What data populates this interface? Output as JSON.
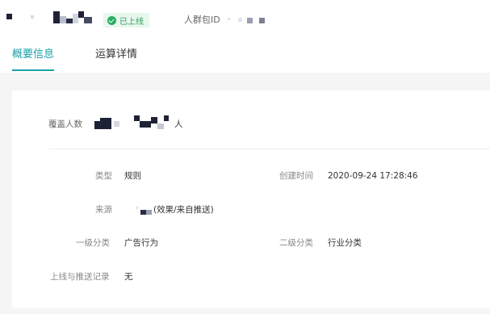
{
  "header": {
    "status": "已上线",
    "crowd_id_label": "人群包ID"
  },
  "tabs": [
    {
      "label": "概要信息",
      "active": true
    },
    {
      "label": "运算详情",
      "active": false
    }
  ],
  "coverage": {
    "label": "覆盖人数",
    "unit": "人"
  },
  "fields": {
    "type": {
      "label": "类型",
      "value": "规则"
    },
    "created_time": {
      "label": "创建时间",
      "value": "2020-09-24 17:28:46"
    },
    "source": {
      "label": "来源",
      "value": "(效果/来自推送)"
    },
    "level1": {
      "label": "一级分类",
      "value": "广告行为"
    },
    "level2": {
      "label": "二级分类",
      "value": "行业分类"
    },
    "push_record": {
      "label": "上线与推送记录",
      "value": "无"
    }
  },
  "colors": {
    "accent": "#1aa0a8",
    "status_green": "#27ae60",
    "status_bg": "#e8f7ee",
    "content_bg": "#f5f5f5"
  }
}
